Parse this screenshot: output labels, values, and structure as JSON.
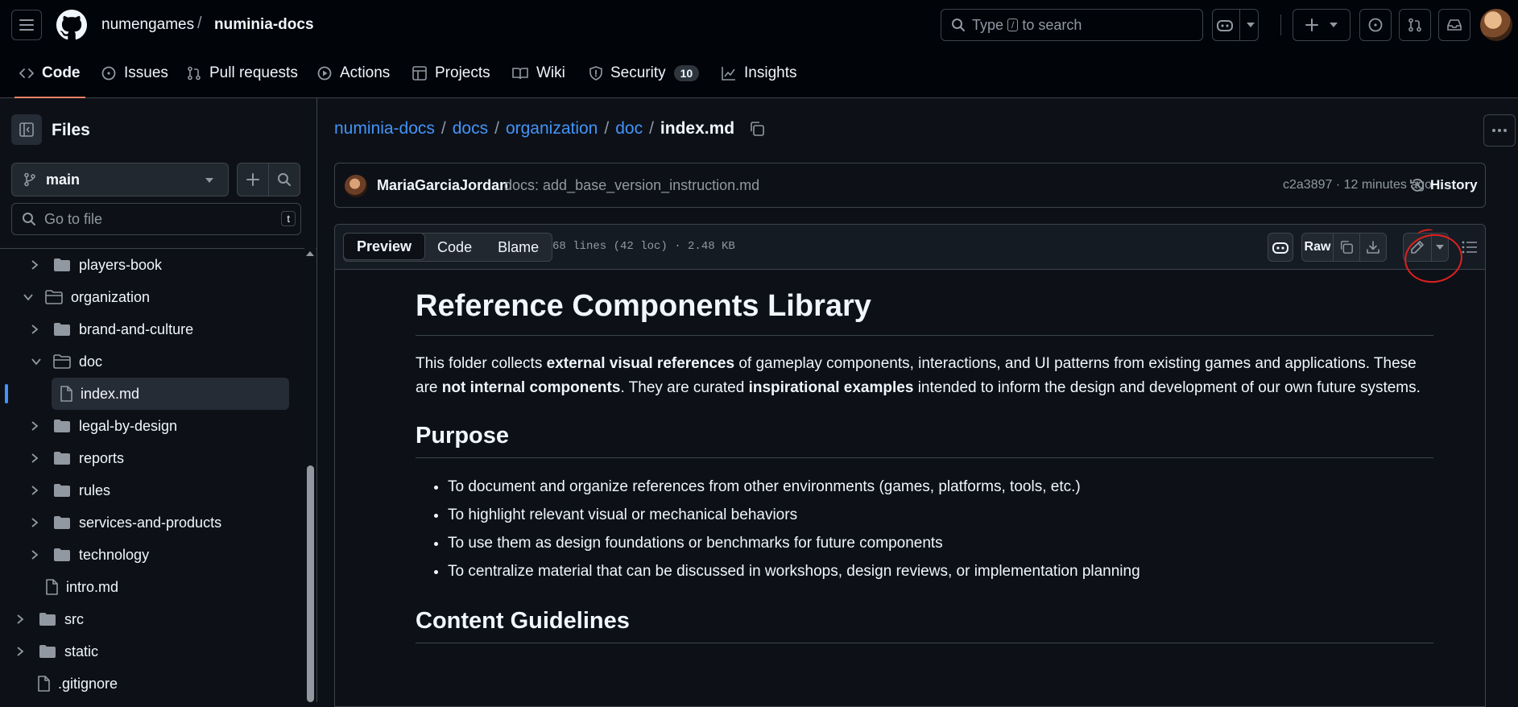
{
  "header": {
    "owner": "numengames",
    "separator": "/",
    "repo": "numinia-docs",
    "search_prefix": "Type",
    "search_key": "/",
    "search_suffix": "to search"
  },
  "repo_nav": {
    "tabs": [
      {
        "label": "Code"
      },
      {
        "label": "Issues"
      },
      {
        "label": "Pull requests"
      },
      {
        "label": "Actions"
      },
      {
        "label": "Projects"
      },
      {
        "label": "Wiki"
      },
      {
        "label": "Security",
        "count": "10"
      },
      {
        "label": "Insights"
      }
    ]
  },
  "sidebar": {
    "title": "Files",
    "branch": "main",
    "goto_placeholder": "Go to file",
    "goto_key": "t",
    "tree": [
      {
        "label": "players-book",
        "type": "folder",
        "expanded": false
      },
      {
        "label": "organization",
        "type": "folder",
        "expanded": true
      },
      {
        "label": "brand-and-culture",
        "type": "folder",
        "expanded": false
      },
      {
        "label": "doc",
        "type": "folder",
        "expanded": true
      },
      {
        "label": "index.md",
        "type": "file",
        "selected": true
      },
      {
        "label": "legal-by-design",
        "type": "folder",
        "expanded": false
      },
      {
        "label": "reports",
        "type": "folder",
        "expanded": false
      },
      {
        "label": "rules",
        "type": "folder",
        "expanded": false
      },
      {
        "label": "services-and-products",
        "type": "folder",
        "expanded": false
      },
      {
        "label": "technology",
        "type": "folder",
        "expanded": false
      },
      {
        "label": "intro.md",
        "type": "file"
      },
      {
        "label": "src",
        "type": "folder",
        "expanded": false
      },
      {
        "label": "static",
        "type": "folder",
        "expanded": false
      },
      {
        "label": ".gitignore",
        "type": "file"
      }
    ]
  },
  "breadcrumb": {
    "parts": [
      "numinia-docs",
      "docs",
      "organization",
      "doc"
    ],
    "separator": "/",
    "current": "index.md"
  },
  "commit": {
    "author": "MariaGarciaJordan",
    "message": "docs: add_base_version_instruction.md",
    "meta": "c2a3897 · 12 minutes ago",
    "history_label": "History"
  },
  "file": {
    "view_tabs": [
      "Preview",
      "Code",
      "Blame"
    ],
    "active_tab": "Preview",
    "meta": "68 lines (42 loc) · 2.48 KB",
    "raw_label": "Raw"
  },
  "markdown": {
    "h1": "Reference Components Library",
    "intro": [
      {
        "t": "This folder collects ",
        "b": false
      },
      {
        "t": "external visual references",
        "b": true
      },
      {
        "t": " of gameplay components, interactions, and UI patterns from existing games and applications. These are ",
        "b": false
      },
      {
        "t": "not internal components",
        "b": true
      },
      {
        "t": ". They are curated ",
        "b": false
      },
      {
        "t": "inspirational examples",
        "b": true
      },
      {
        "t": " intended to inform the design and development of our own future systems.",
        "b": false
      }
    ],
    "h2_purpose": "Purpose",
    "purpose_items": [
      "To document and organize references from other environments (games, platforms, tools, etc.)",
      "To highlight relevant visual or mechanical behaviors",
      "To use them as design foundations or benchmarks for future components",
      "To centralize material that can be discussed in workshops, design reviews, or implementation planning"
    ],
    "h2_guidelines": "Content Guidelines"
  },
  "colors": {
    "accent_link": "#4493f8",
    "active_tab_underline": "#f78166",
    "annotation": "#e02020"
  }
}
